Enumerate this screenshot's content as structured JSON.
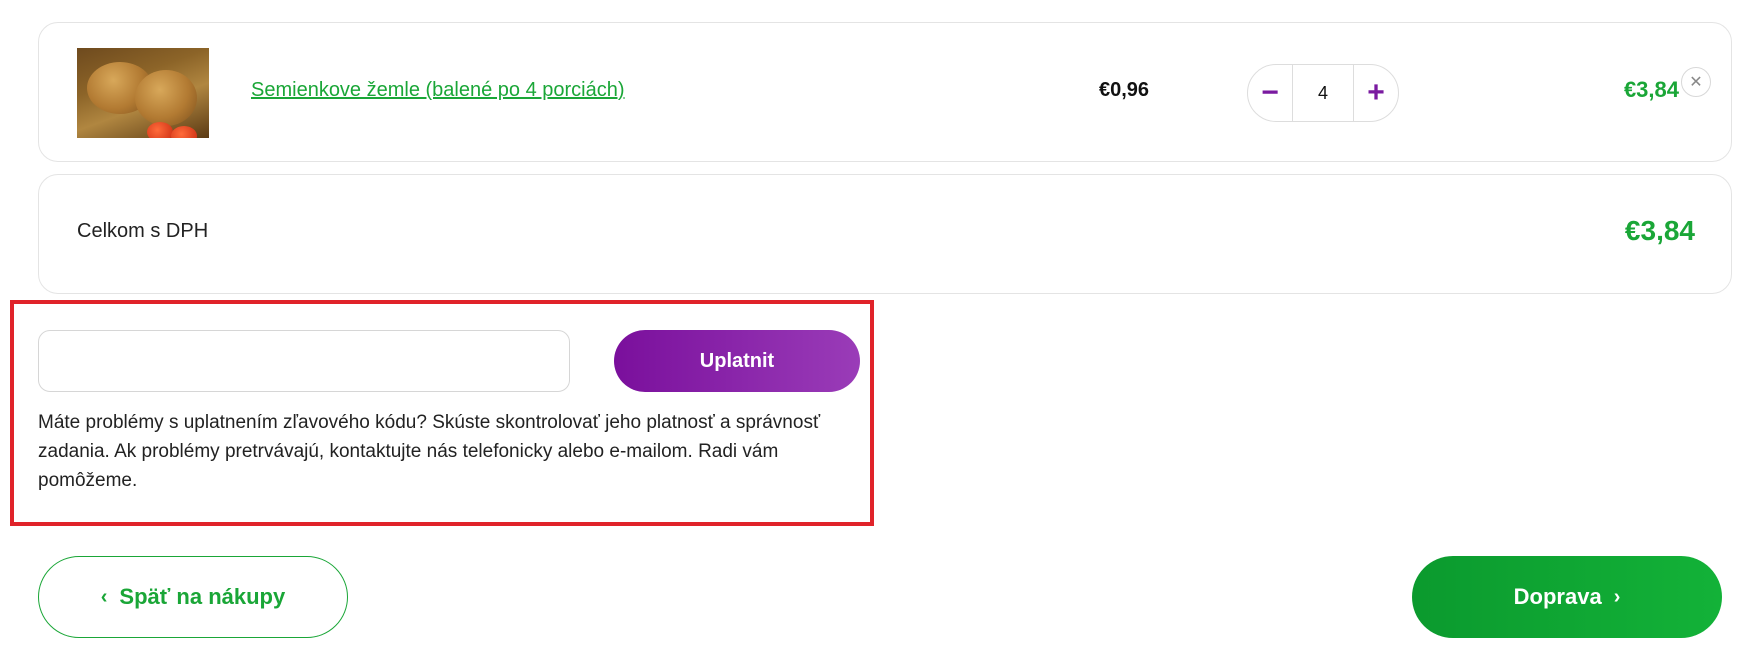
{
  "cart": {
    "items": [
      {
        "name": "Semienkove žemle (balené po 4 porciách)",
        "unit_price": "€0,96",
        "quantity": "4",
        "line_total": "€3,84",
        "image_icon": "bread-rolls-photo",
        "remove_icon": "close-icon"
      }
    ],
    "total_label": "Celkom s DPH",
    "total_value": "€3,84"
  },
  "coupon": {
    "input_value": "",
    "input_placeholder": "",
    "apply_label": "Uplatnit",
    "help_text": "Máte problémy s uplatnením zľavového kódu? Skúste skontrolovať jeho platnosť a správnosť zadania. Ak problémy pretrvávajú, kontaktujte nás telefonicky alebo e-mailom. Radi vám pomôžeme."
  },
  "navigation": {
    "back_label": "Späť na nákupy",
    "next_label": "Doprava"
  },
  "colors": {
    "brand_green": "#1aa637",
    "brand_purple": "#7a0f9c",
    "highlight_red": "#e0232a"
  }
}
